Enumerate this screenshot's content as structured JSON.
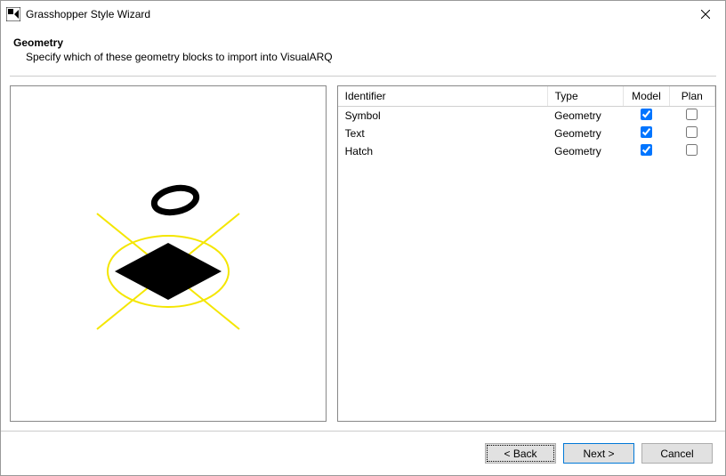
{
  "window": {
    "title": "Grasshopper Style Wizard"
  },
  "header": {
    "title": "Geometry",
    "subtitle": "Specify which of these geometry blocks to import into VisualARQ"
  },
  "table": {
    "columns": {
      "identifier": "Identifier",
      "type": "Type",
      "model": "Model",
      "plan": "Plan"
    },
    "rows": [
      {
        "identifier": "Symbol",
        "type": "Geometry",
        "model": true,
        "plan": false
      },
      {
        "identifier": "Text",
        "type": "Geometry",
        "model": true,
        "plan": false
      },
      {
        "identifier": "Hatch",
        "type": "Geometry",
        "model": true,
        "plan": false
      }
    ]
  },
  "buttons": {
    "back": "< Back",
    "next": "Next >",
    "cancel": "Cancel"
  }
}
